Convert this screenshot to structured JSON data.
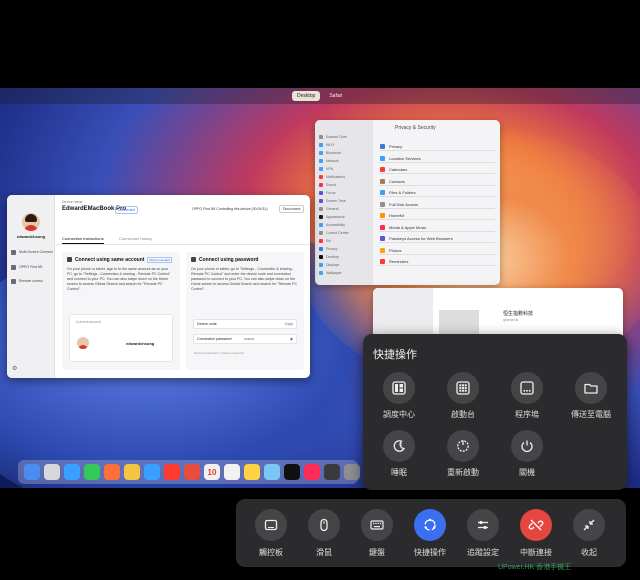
{
  "topbar": {
    "tabs": [
      "Desktop",
      "Safari"
    ]
  },
  "settings_window": {
    "title": "Privacy & Security",
    "rows": [
      "Privacy",
      "Location Services",
      "Calendars",
      "Contacts",
      "Files & Folders",
      "Full Disk Access",
      "HomeKit",
      "Media & Apple Music",
      "Passkeys Access for Web Browsers",
      "Photos",
      "Reminders"
    ],
    "sidebar": [
      "Edward Chen",
      "Wi-Fi",
      "Bluetooth",
      "Network",
      "VPN",
      "Notifications",
      "Sound",
      "Focus",
      "Screen Time",
      "General",
      "Appearance",
      "Accessibility",
      "Control Center",
      "Siri",
      "Privacy",
      "Desktop",
      "Displays",
      "Wallpaper"
    ]
  },
  "finder_window": {
    "file_name": "恒生指數科技",
    "file_sub": "iphone.hk"
  },
  "app_window": {
    "user_name": "edwardchsong",
    "nav": [
      "Multi-Screen Connect",
      "OPPO Find N5",
      "Remote control"
    ],
    "device_label": "Device name",
    "device_name": "EdwardEMacBook Pro",
    "device_badge": "Connected",
    "status": "OPPO Find N5 Controlling this device (00:05:31)",
    "disconnect": "Disconnect",
    "tabs": [
      "Connection instructions",
      "Connection history"
    ],
    "card1": {
      "title": "Connect using same account",
      "badge": "Recommended",
      "body": "On your phone or tablet, sign in to the same account as on your PC, go to \"Settings - Connection & sharing - Remote PC Control\" and connect to your PC. You can also swipe down on the Home screen to access Global Search and search for \"Remote PC Control\".",
      "account_label": "Current account",
      "account": "edwardchsong"
    },
    "card2": {
      "title": "Connect using password",
      "body": "On your phone or tablet, go to \"Settings - Connection & sharing - Remote PC Control\" and enter the device code and connection password to connect to your PC. You can also swipe down on the Home screen to access Global Search and search for \"Remote PC Control\".",
      "device_code_label": "Device code",
      "device_code_action": "Copy",
      "password_label": "Connection password",
      "password_value": "••••••••",
      "hint": "Refresh password / Update password"
    }
  },
  "dock": {
    "colors": [
      "#4a8cf0",
      "#d7d7dc",
      "#3aa0ff",
      "#34c759",
      "#ff6f3c",
      "#f5c542",
      "#3aa0ff",
      "#ff3b30",
      "#e74c3c",
      "#f0f0f0",
      "#f2f2f2",
      "#ffd23f",
      "#7bc6f5",
      "#111111",
      "#ff2d55",
      "#3a3a3c",
      "#8e8e93",
      "#2a6fd6"
    ],
    "calendar_day": "10"
  },
  "quick_panel": {
    "title": "快捷操作",
    "items": [
      {
        "label": "調度中心",
        "icon": "mission-control-icon"
      },
      {
        "label": "啟動台",
        "icon": "launchpad-icon"
      },
      {
        "label": "程序塢",
        "icon": "dock-icon"
      },
      {
        "label": "傳送至電腦",
        "icon": "folder-icon"
      },
      {
        "label": "睡眠",
        "icon": "sleep-icon"
      },
      {
        "label": "重新啟動",
        "icon": "restart-icon"
      },
      {
        "label": "關機",
        "icon": "power-icon"
      }
    ]
  },
  "toolbar": {
    "items": [
      {
        "label": "觸控板",
        "icon": "trackpad-icon"
      },
      {
        "label": "滑鼠",
        "icon": "mouse-icon"
      },
      {
        "label": "鍵盤",
        "icon": "keyboard-icon"
      },
      {
        "label": "快捷操作",
        "icon": "quick-actions-icon",
        "active": true
      },
      {
        "label": "追蹤設定",
        "icon": "tracking-settings-icon"
      },
      {
        "label": "中斷連接",
        "icon": "disconnect-icon",
        "danger": true
      },
      {
        "label": "收起",
        "icon": "collapse-icon"
      }
    ],
    "accent": "#3a6ff0",
    "danger": "#e5463f"
  },
  "watermark": "UPower.HK 香港手機王"
}
